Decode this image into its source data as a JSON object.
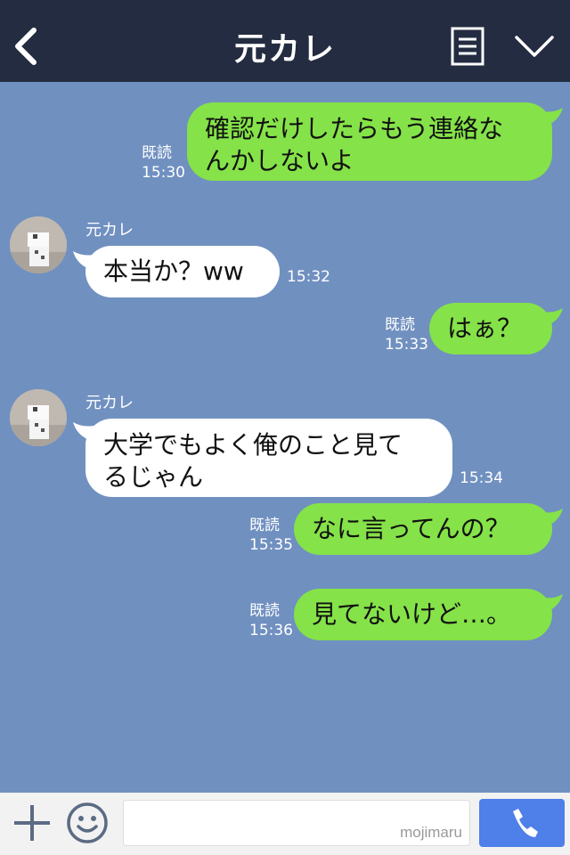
{
  "header": {
    "title": "元カレ",
    "back_icon": "chevron-left-icon",
    "menu_icon": "menu-list-icon",
    "collapse_icon": "chevron-down-icon"
  },
  "messages": [
    {
      "side": "me",
      "lines": [
        "確認だけしたらもう連絡な",
        "んかしないよ"
      ],
      "read": "既読",
      "time": "15:30"
    },
    {
      "side": "them",
      "sender": "元カレ",
      "lines": [
        "本当か？ww"
      ],
      "time": "15:32"
    },
    {
      "side": "me",
      "lines": [
        "はぁ？"
      ],
      "read": "既読",
      "time": "15:33"
    },
    {
      "side": "them",
      "sender": "元カレ",
      "lines": [
        "大学でもよく俺のこと見て",
        "るじゃん"
      ],
      "time": "15:34"
    },
    {
      "side": "me",
      "lines": [
        "なに言ってんの？"
      ],
      "read": "既読",
      "time": "15:35"
    },
    {
      "side": "me",
      "lines": [
        "見てないけど…。"
      ],
      "read": "既読",
      "time": "15:36"
    }
  ],
  "footer": {
    "input_value": "",
    "watermark": "mojimaru",
    "plus_icon": "plus-icon",
    "emoji_icon": "smiley-icon",
    "call_icon": "phone-icon"
  },
  "colors": {
    "header_bg": "#232c40",
    "chat_bg": "#7090c0",
    "my_bubble": "#85e249",
    "their_bubble": "#ffffff",
    "call_button": "#4f7fe8"
  }
}
